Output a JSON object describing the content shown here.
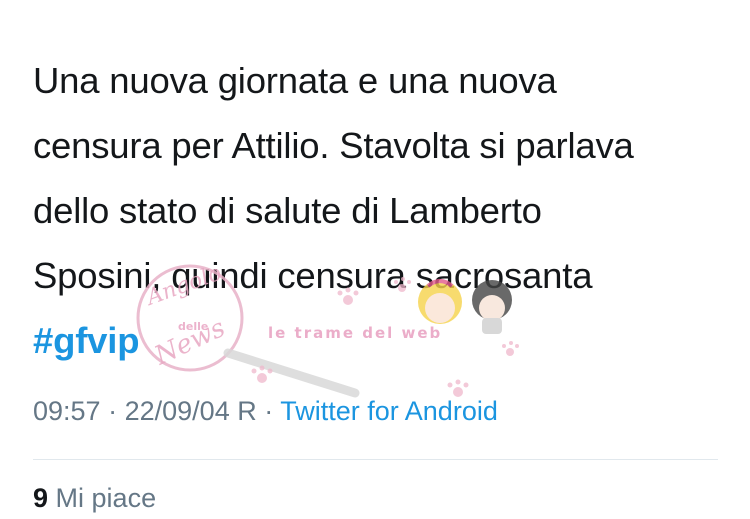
{
  "tweet": {
    "lines": [
      "Una nuova giornata e una nuova",
      "censura per Attilio. Stavolta si parlava",
      "dello stato di salute di Lamberto",
      "Sposini, quindi censura sacrosanta"
    ],
    "hashtag": "#gfvip"
  },
  "meta": {
    "time": "09:57",
    "separator": "·",
    "date": "22/09/04 R",
    "source": "Twitter for Android"
  },
  "stats": {
    "likes_count": "9",
    "likes_label": "Mi piace"
  },
  "watermark": {
    "logo_text_1": "Angolo",
    "logo_text_2": "delle",
    "logo_text_3": "News",
    "site_text": "le trame del web"
  },
  "colors": {
    "text": "#14171a",
    "link": "#1b95e0",
    "muted": "#657786",
    "divider": "#e1e8ed",
    "watermark_pink": "#e8a8c3"
  }
}
